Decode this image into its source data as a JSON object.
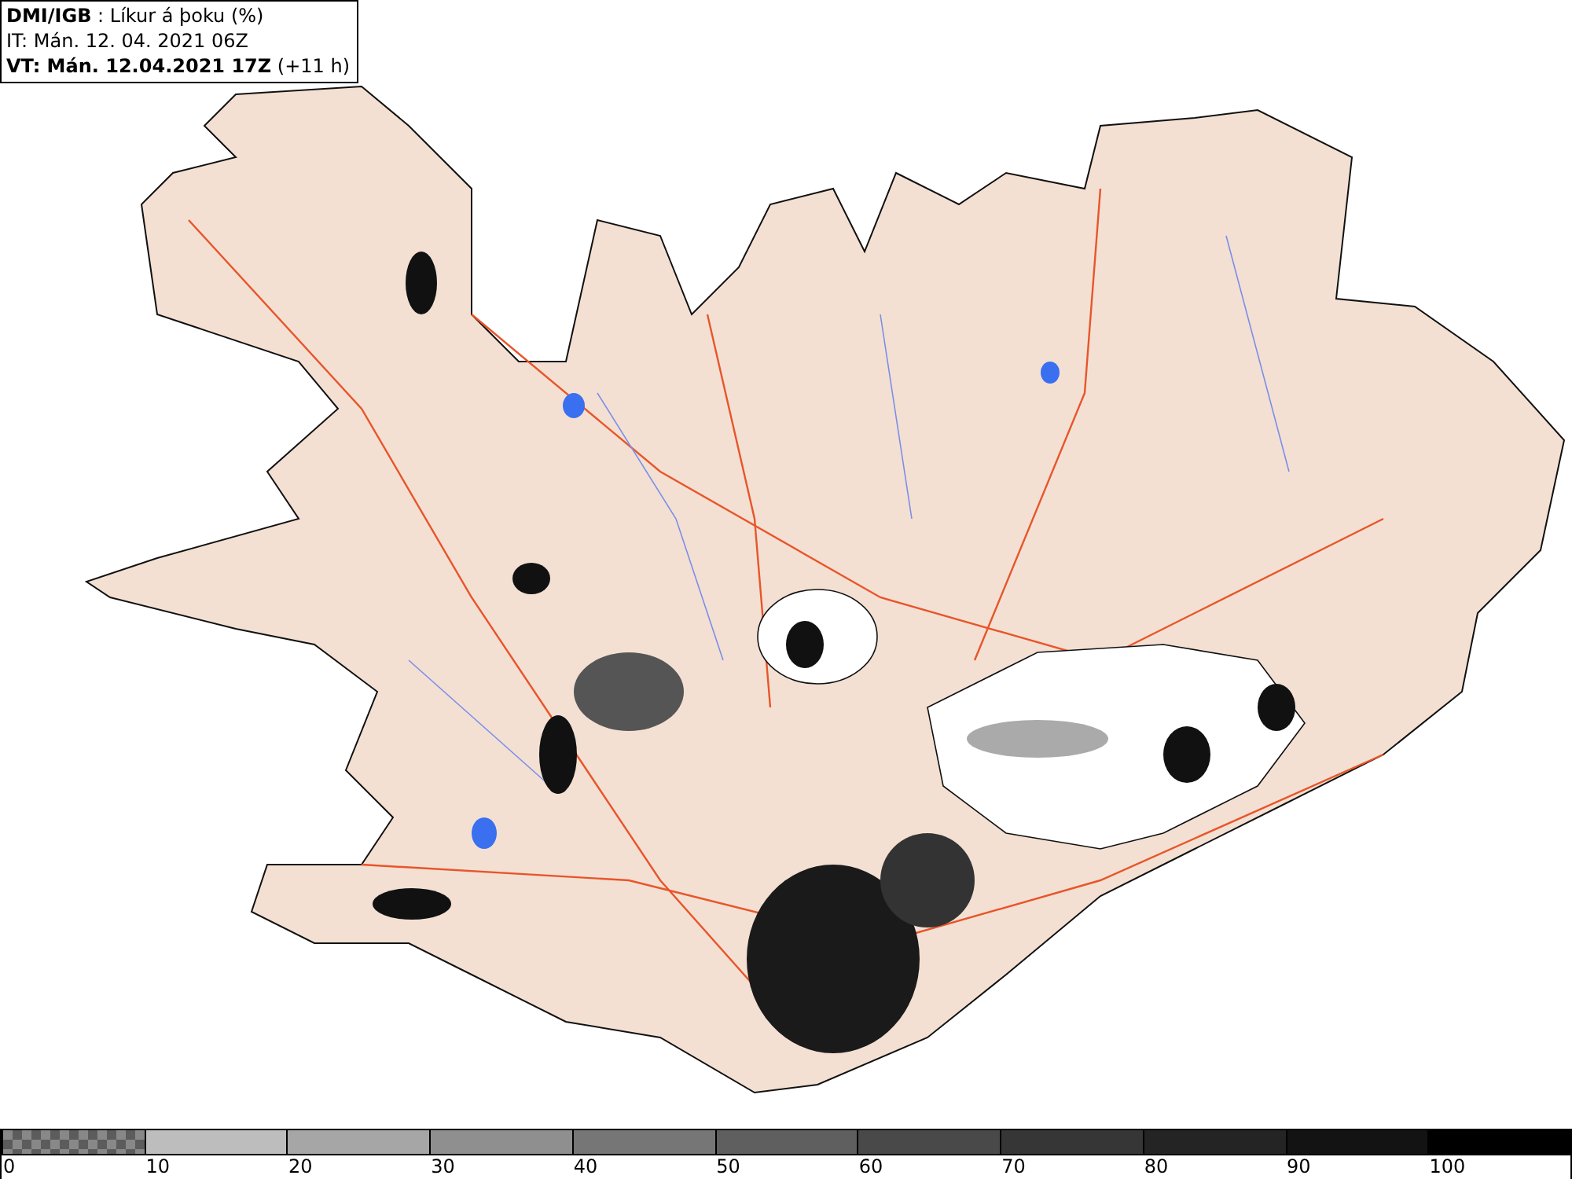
{
  "header": {
    "lines": [
      "**DMI/IGB** : Líkur á þoku (%)",
      "IT: Mán. 12. 04. 2021 06Z",
      "**VT: Mán. 12.04.2021 17Z** (+11 h)"
    ]
  },
  "legend": {
    "segments": [
      {
        "kind": "checker",
        "color": "#5c5c5c"
      },
      {
        "kind": "solid",
        "color": "#bdbdbd"
      },
      {
        "kind": "solid",
        "color": "#a6a6a6"
      },
      {
        "kind": "solid",
        "color": "#8f8f8f"
      },
      {
        "kind": "solid",
        "color": "#767676"
      },
      {
        "kind": "solid",
        "color": "#5f5f5f"
      },
      {
        "kind": "solid",
        "color": "#494949"
      },
      {
        "kind": "solid",
        "color": "#363636"
      },
      {
        "kind": "solid",
        "color": "#242424"
      },
      {
        "kind": "solid",
        "color": "#131313"
      },
      {
        "kind": "solid",
        "color": "#000000"
      }
    ],
    "labels": [
      "0",
      "10",
      "20",
      "30",
      "40",
      "50",
      "60",
      "70",
      "80",
      "90",
      "100"
    ]
  }
}
